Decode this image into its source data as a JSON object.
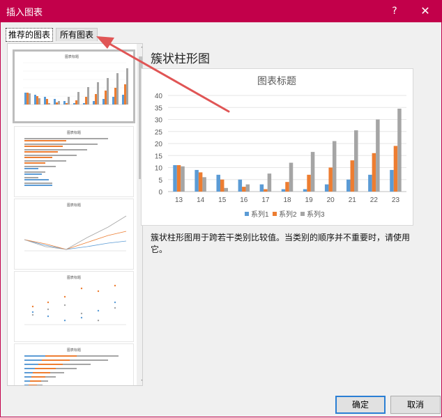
{
  "window": {
    "title": "插入图表",
    "help_label": "?",
    "close_label": "✕"
  },
  "tabs": [
    {
      "label": "推荐的图表",
      "active": true
    },
    {
      "label": "所有图表",
      "active": false
    }
  ],
  "thumbnails": [
    {
      "title": "图表标题",
      "type": "clustered-column",
      "selected": true
    },
    {
      "title": "图表标题",
      "type": "clustered-bar"
    },
    {
      "title": "图表标题",
      "type": "line"
    },
    {
      "title": "图表标题",
      "type": "scatter"
    },
    {
      "title": "图表标题",
      "type": "stacked-bar"
    }
  ],
  "preview": {
    "heading": "簇状柱形图",
    "description": "簇状柱形图用于跨若干类别比较值。当类别的顺序并不重要时，请使用它。"
  },
  "chart_data": {
    "type": "bar",
    "title": "图表标题",
    "categories": [
      "13",
      "14",
      "15",
      "16",
      "17",
      "18",
      "19",
      "20",
      "21",
      "22",
      "23"
    ],
    "series": [
      {
        "name": "系列1",
        "color": "#5b9bd5",
        "values": [
          11,
          9,
          7,
          5,
          3,
          1,
          1,
          3,
          5,
          7,
          9
        ]
      },
      {
        "name": "系列2",
        "color": "#ed7d31",
        "values": [
          11,
          8,
          5,
          2,
          1,
          4,
          7,
          10,
          13,
          16,
          19
        ]
      },
      {
        "name": "系列3",
        "color": "#a5a5a5",
        "values": [
          10.5,
          6,
          1.5,
          3,
          7.5,
          12,
          16.5,
          21,
          25.5,
          30,
          34.5
        ]
      }
    ],
    "ylim": [
      0,
      40
    ],
    "yticks": [
      "0",
      "5",
      "10",
      "15",
      "20",
      "25",
      "30",
      "35",
      "40"
    ],
    "grid": true,
    "legend": "bottom"
  },
  "buttons": {
    "ok": "确定",
    "cancel": "取消"
  },
  "icons": {
    "scroll_up": "⌃",
    "scroll_down": "⌄"
  },
  "colors": {
    "titlebar": "#c2004a",
    "annotation_arrow": "#e05555"
  }
}
